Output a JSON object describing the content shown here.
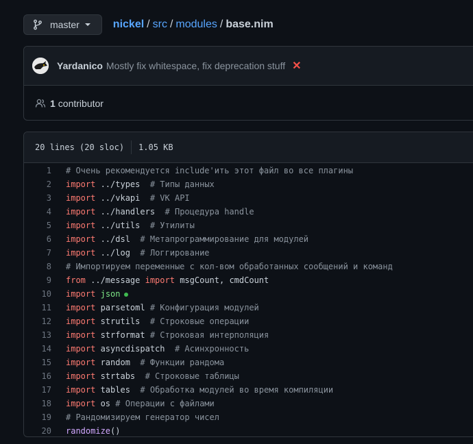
{
  "branch": {
    "label": "master",
    "icon": "git-branch-icon"
  },
  "breadcrumb": {
    "repo": "nickel",
    "parts": [
      "src",
      "modules"
    ],
    "file": "base.nim",
    "sep": "/"
  },
  "commit": {
    "author": "Yardanico",
    "message": "Mostly fix whitespace, fix deprecation stuff",
    "status_glyph": "✕",
    "status_color": "#f85149"
  },
  "contributors": {
    "count": "1",
    "label": "contributor"
  },
  "file_info": {
    "lines": "20 lines (20 sloc)",
    "size": "1.05 KB"
  },
  "code_lines": [
    {
      "n": "1",
      "tokens": [
        {
          "t": "c",
          "v": "# Очень рекомендуется include'ить этот файл во все плагины"
        }
      ]
    },
    {
      "n": "2",
      "tokens": [
        {
          "t": "k",
          "v": "import"
        },
        {
          "t": "p",
          "v": " ../types  "
        },
        {
          "t": "c",
          "v": "# Типы данных"
        }
      ]
    },
    {
      "n": "3",
      "tokens": [
        {
          "t": "k",
          "v": "import"
        },
        {
          "t": "p",
          "v": " ../vkapi  "
        },
        {
          "t": "c",
          "v": "# VK API"
        }
      ]
    },
    {
      "n": "4",
      "tokens": [
        {
          "t": "k",
          "v": "import"
        },
        {
          "t": "p",
          "v": " ../handlers  "
        },
        {
          "t": "c",
          "v": "# Процедура handle"
        }
      ]
    },
    {
      "n": "5",
      "tokens": [
        {
          "t": "k",
          "v": "import"
        },
        {
          "t": "p",
          "v": " ../utils  "
        },
        {
          "t": "c",
          "v": "# Утилиты"
        }
      ]
    },
    {
      "n": "6",
      "tokens": [
        {
          "t": "k",
          "v": "import"
        },
        {
          "t": "p",
          "v": " ../dsl  "
        },
        {
          "t": "c",
          "v": "# Метапрограммирование для модулей"
        }
      ]
    },
    {
      "n": "7",
      "tokens": [
        {
          "t": "k",
          "v": "import"
        },
        {
          "t": "p",
          "v": " ../log  "
        },
        {
          "t": "c",
          "v": "# Логгирование"
        }
      ]
    },
    {
      "n": "8",
      "tokens": [
        {
          "t": "c",
          "v": "# Импортируем переменные с кол-вом обработанных сообщений и команд"
        }
      ]
    },
    {
      "n": "9",
      "tokens": [
        {
          "t": "k",
          "v": "from"
        },
        {
          "t": "p",
          "v": " ../message "
        },
        {
          "t": "k",
          "v": "import"
        },
        {
          "t": "p",
          "v": " msgCount, cmdCount"
        }
      ]
    },
    {
      "n": "10",
      "tokens": [
        {
          "t": "k",
          "v": "import"
        },
        {
          "t": "p",
          "v": " "
        },
        {
          "t": "s",
          "v": "json"
        },
        {
          "t": "dot",
          "v": ""
        }
      ]
    },
    {
      "n": "11",
      "tokens": [
        {
          "t": "k",
          "v": "import"
        },
        {
          "t": "p",
          "v": " parsetoml "
        },
        {
          "t": "c",
          "v": "# Конфигурация модулей"
        }
      ]
    },
    {
      "n": "12",
      "tokens": [
        {
          "t": "k",
          "v": "import"
        },
        {
          "t": "p",
          "v": " strutils  "
        },
        {
          "t": "c",
          "v": "# Строковые операции"
        }
      ]
    },
    {
      "n": "13",
      "tokens": [
        {
          "t": "k",
          "v": "import"
        },
        {
          "t": "p",
          "v": " strformat "
        },
        {
          "t": "c",
          "v": "# Строковая интерполяция"
        }
      ]
    },
    {
      "n": "14",
      "tokens": [
        {
          "t": "k",
          "v": "import"
        },
        {
          "t": "p",
          "v": " asyncdispatch  "
        },
        {
          "t": "c",
          "v": "# Асинхронность"
        }
      ]
    },
    {
      "n": "15",
      "tokens": [
        {
          "t": "k",
          "v": "import"
        },
        {
          "t": "p",
          "v": " random  "
        },
        {
          "t": "c",
          "v": "# Функции рандома"
        }
      ]
    },
    {
      "n": "16",
      "tokens": [
        {
          "t": "k",
          "v": "import"
        },
        {
          "t": "p",
          "v": " strtabs  "
        },
        {
          "t": "c",
          "v": "# Строковые таблицы"
        }
      ]
    },
    {
      "n": "17",
      "tokens": [
        {
          "t": "k",
          "v": "import"
        },
        {
          "t": "p",
          "v": " tables  "
        },
        {
          "t": "c",
          "v": "# Обработка модулей во время компиляции"
        }
      ]
    },
    {
      "n": "18",
      "tokens": [
        {
          "t": "k",
          "v": "import"
        },
        {
          "t": "p",
          "v": " os "
        },
        {
          "t": "c",
          "v": "# Операции с файлами"
        }
      ]
    },
    {
      "n": "19",
      "tokens": [
        {
          "t": "c",
          "v": "# Рандомизируем генератор чисел"
        }
      ]
    },
    {
      "n": "20",
      "tokens": [
        {
          "t": "f",
          "v": "randomize"
        },
        {
          "t": "p",
          "v": "()"
        }
      ]
    }
  ]
}
